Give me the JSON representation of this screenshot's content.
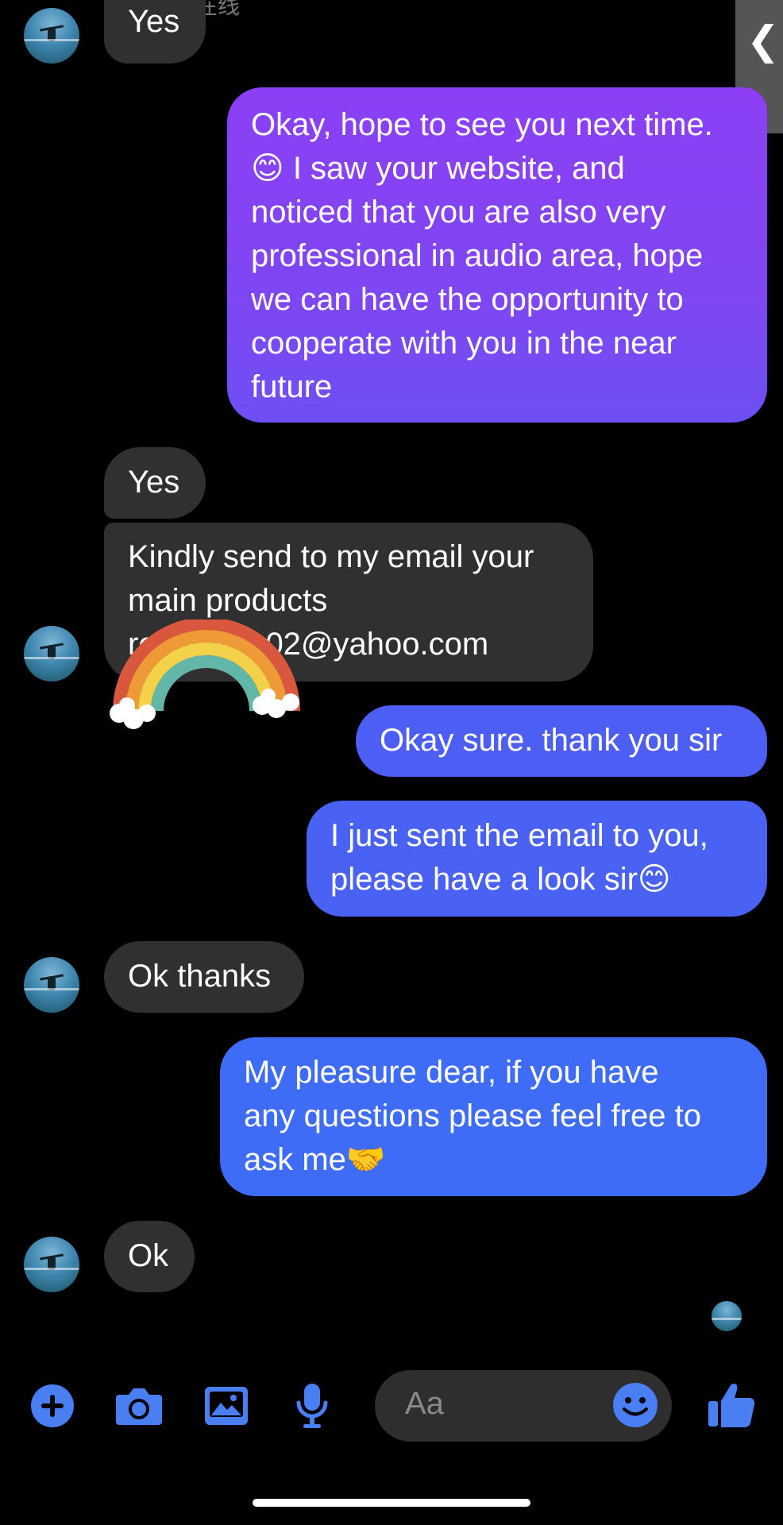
{
  "header": {
    "status_text": "在线",
    "collapse_glyph": "❮"
  },
  "messages": [
    {
      "from": "them",
      "text": "Yes"
    },
    {
      "from": "me",
      "text": "Okay, hope to see you next time. 😊 I saw your website, and noticed that you are also very professional in audio area, hope we can have the opportunity to cooperate with you in the near future"
    },
    {
      "from": "them",
      "text": "Yes"
    },
    {
      "from": "them",
      "text": "Kindly send to my email your main products re…guel_02@yahoo.com"
    },
    {
      "from": "me",
      "text": "Okay sure. thank you sir"
    },
    {
      "from": "me",
      "text": "I just sent the email to you, please have a look sir😊"
    },
    {
      "from": "them",
      "text": "Ok thanks"
    },
    {
      "from": "me",
      "text": "My pleasure dear, if you have any questions please feel free to ask me🤝"
    },
    {
      "from": "them",
      "text": "Ok"
    }
  ],
  "bubble_lines": {
    "m1": [
      "Yes"
    ],
    "m2": [
      "Okay, hope to see you next time.",
      "😊 I saw your website, and",
      "noticed that you are also very",
      "professional in audio area, hope",
      "we can have the opportunity to",
      "cooperate with you in the near",
      "future"
    ],
    "m3": [
      "Yes"
    ],
    "m4": [
      "Kindly send to my email your",
      "main products",
      "re…guel_02@yahoo.com"
    ],
    "m5": [
      "Okay sure. thank you sir"
    ],
    "m6": [
      "I just sent the email to you,",
      "please have a look sir😊"
    ],
    "m7": [
      "Ok thanks"
    ],
    "m8": [
      "My pleasure dear, if you have",
      "any questions please feel free to",
      "ask me🤝"
    ],
    "m9": [
      "Ok"
    ]
  },
  "composer": {
    "placeholder": "Aa",
    "icons": [
      "plus-icon",
      "camera-icon",
      "gallery-icon",
      "microphone-icon",
      "emoji-icon",
      "thumbs-up-icon"
    ]
  },
  "colors": {
    "accent": "#4a7ff4",
    "incoming_bubble": "#303030",
    "outgoing_purple": "#8c3ff4",
    "outgoing_blue": "#3e6cf6",
    "background": "#000000"
  },
  "sticker": "rainbow-sticker"
}
